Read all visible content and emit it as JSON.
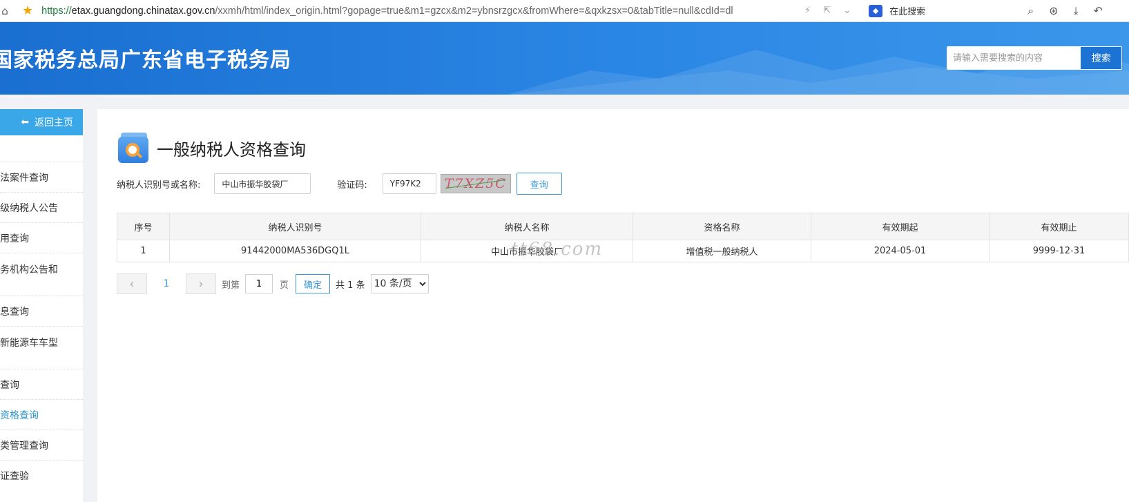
{
  "browser": {
    "home_icon": "home-icon",
    "star_icon": "star-icon",
    "url_scheme": "https://",
    "url_host": "etax.guangdong.chinatax.gov.cn",
    "url_path": "/xxmh/html/index_origin.html?gopage=true&m1=gzcx&m2=ybnsrzgcx&fromWhere=&qxkzsx=0&tabTitle=null&cdId=dl",
    "search_label": "在此搜索"
  },
  "header": {
    "site_title": "国家税务总局广东省电子税务局",
    "search_placeholder": "请输入需要搜索的内容",
    "search_button": "搜索"
  },
  "sidebar": {
    "back_label": "返回主页",
    "items": [
      {
        "label": "法案件查询"
      },
      {
        "label": "级纳税人公告"
      },
      {
        "label": "用查询"
      },
      {
        "label": "务机构公告和"
      },
      {
        "label": "息查询"
      },
      {
        "label": "新能源车车型"
      },
      {
        "label": "查询"
      },
      {
        "label": "资格查询"
      },
      {
        "label": "类管理查询"
      },
      {
        "label": "证查验"
      }
    ]
  },
  "page": {
    "title": "一般纳税人资格查询"
  },
  "form": {
    "taxpayer_label": "纳税人识别号或名称:",
    "taxpayer_value": "中山市振华胶袋厂",
    "captcha_label": "验证码:",
    "captcha_value": "YF97K2",
    "captcha_image_text": "T7XZ5C",
    "query_button": "查询"
  },
  "table": {
    "headers": [
      "序号",
      "纳税人识别号",
      "纳税人名称",
      "资格名称",
      "有效期起",
      "有效期止"
    ],
    "rows": [
      [
        "1",
        "91442000MA536DGQ1L",
        "中山市振华胶袋厂",
        "增值税一般纳税人",
        "2024-05-01",
        "9999-12-31"
      ]
    ]
  },
  "watermark": "tt68.com",
  "pager": {
    "current_page": "1",
    "goto_prefix": "到第",
    "goto_value": "1",
    "goto_suffix": "页",
    "confirm": "确定",
    "total": "共 1 条",
    "page_size": "10 条/页"
  },
  "colors": {
    "banner": "#1a6fd0",
    "sidebar_back": "#3aa7e9",
    "accent": "#3c9ad8"
  }
}
